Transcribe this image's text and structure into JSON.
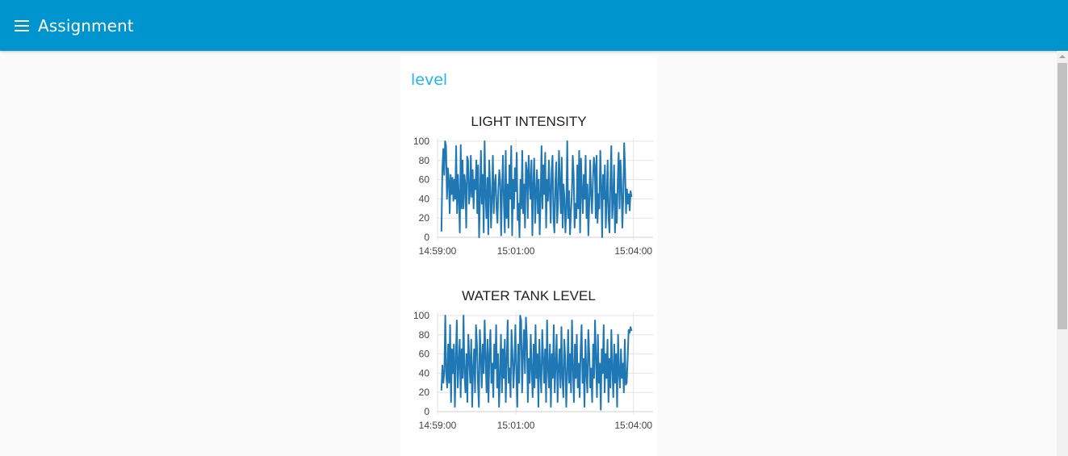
{
  "header": {
    "title": "Assignment",
    "menu_icon": "hamburger-menu-icon",
    "background_color": "#0094ce"
  },
  "group": {
    "title": "level",
    "title_color": "#1bb5ef"
  },
  "charts": [
    {
      "title": "LIGHT INTENSITY",
      "line_color": "#1f77b4"
    },
    {
      "title": "WATER TANK LEVEL",
      "line_color": "#1f77b4"
    }
  ],
  "chart_data": [
    {
      "type": "line",
      "title": "LIGHT INTENSITY",
      "xlabel": "",
      "ylabel": "",
      "ylim": [
        0,
        100
      ],
      "yticks": [
        "0",
        "20",
        "40",
        "60",
        "80",
        "100"
      ],
      "xticks": [
        "14:59:00",
        "15:01:00",
        "15:04:00"
      ],
      "xtick_minutes": [
        0,
        2,
        5
      ],
      "xlim_minutes": [
        0,
        5.5
      ],
      "x_start_minutes": 0.1,
      "x_end_minutes": 4.95,
      "grid": true,
      "series": [
        {
          "values": [
            6,
            70,
            92,
            65,
            100,
            95,
            40,
            72,
            60,
            25,
            65,
            45,
            62,
            38,
            60,
            40,
            95,
            25,
            65,
            40,
            5,
            96,
            30,
            80,
            30,
            65,
            55,
            10,
            84,
            80,
            35,
            45,
            85,
            42,
            70,
            30,
            60,
            50,
            80,
            25,
            75,
            0,
            42,
            90,
            35,
            65,
            5,
            100,
            45,
            20,
            62,
            3,
            80,
            55,
            10,
            40,
            85,
            25,
            55,
            65,
            30,
            15,
            50,
            70,
            58,
            2,
            50,
            85,
            35,
            5,
            90,
            20,
            55,
            10,
            75,
            40,
            95,
            2,
            60,
            30,
            72,
            48,
            88,
            18,
            35,
            0,
            60,
            30,
            90,
            25,
            55,
            10,
            78,
            70,
            20,
            85,
            60,
            40,
            80,
            2,
            55,
            82,
            15,
            45,
            70,
            25,
            60,
            3,
            42,
            95,
            30,
            75,
            45,
            88,
            10,
            60,
            38,
            80,
            48,
            15,
            70,
            85,
            20,
            5,
            55,
            78,
            15,
            35,
            90,
            58,
            25,
            83,
            10,
            55,
            40,
            5,
            30,
            100,
            20,
            48,
            3,
            25,
            45,
            85,
            65,
            10,
            35,
            20,
            75,
            30,
            90,
            5,
            82,
            48,
            25,
            65,
            40,
            85,
            20,
            55,
            2,
            35,
            80,
            45,
            25,
            60,
            83,
            75,
            20,
            85,
            15,
            45,
            30,
            90,
            55,
            0,
            65,
            40,
            75,
            10,
            40,
            80,
            20,
            5,
            58,
            95,
            20,
            40,
            75,
            5,
            45,
            15,
            60,
            88,
            30,
            80,
            55,
            10,
            40,
            98,
            70,
            25,
            50,
            35,
            45,
            28,
            48,
            42
          ]
        }
      ]
    },
    {
      "type": "line",
      "title": "WATER TANK LEVEL",
      "xlabel": "",
      "ylabel": "",
      "ylim": [
        0,
        100
      ],
      "yticks": [
        "0",
        "20",
        "40",
        "60",
        "80",
        "100"
      ],
      "xticks": [
        "14:59:00",
        "15:01:00",
        "15:04:00"
      ],
      "xtick_minutes": [
        0,
        2,
        5
      ],
      "xlim_minutes": [
        0,
        5.5
      ],
      "x_start_minutes": 0.1,
      "x_end_minutes": 4.95,
      "grid": true,
      "series": [
        {
          "values": [
            22,
            48,
            30,
            42,
            100,
            38,
            25,
            70,
            30,
            90,
            10,
            65,
            40,
            70,
            5,
            55,
            95,
            25,
            50,
            75,
            15,
            65,
            35,
            100,
            40,
            20,
            60,
            10,
            80,
            55,
            30,
            75,
            5,
            45,
            65,
            20,
            90,
            70,
            30,
            5,
            85,
            60,
            25,
            70,
            40,
            95,
            55,
            20,
            75,
            10,
            60,
            85,
            30,
            50,
            15,
            70,
            45,
            90,
            25,
            60,
            5,
            40,
            80,
            20,
            65,
            35,
            75,
            10,
            55,
            95,
            30,
            45,
            15,
            85,
            60,
            25,
            50,
            90,
            40,
            5,
            70,
            30,
            100,
            95,
            20,
            60,
            85,
            40,
            98,
            75,
            10,
            55,
            30,
            80,
            45,
            15,
            70,
            25,
            90,
            35,
            60,
            5,
            75,
            40,
            20,
            85,
            55,
            30,
            65,
            10,
            95,
            45,
            25,
            70,
            5,
            60,
            35,
            90,
            20,
            50,
            80,
            10,
            45,
            65,
            25,
            88,
            35,
            15,
            75,
            55,
            5,
            40,
            85,
            30,
            60,
            20,
            95,
            45,
            10,
            70,
            35,
            80,
            25,
            50,
            15,
            65,
            90,
            30,
            55,
            5,
            75,
            40,
            20,
            85,
            60,
            25,
            45,
            10,
            70,
            35,
            95,
            55,
            15,
            80,
            30,
            50,
            2,
            65,
            40,
            90,
            20,
            60,
            35,
            75,
            10,
            55,
            25,
            85,
            45,
            15,
            70,
            30,
            60,
            5,
            80,
            40,
            25,
            65,
            35,
            50,
            20,
            75,
            28,
            30,
            55,
            85,
            82,
            88,
            84
          ]
        }
      ]
    }
  ]
}
